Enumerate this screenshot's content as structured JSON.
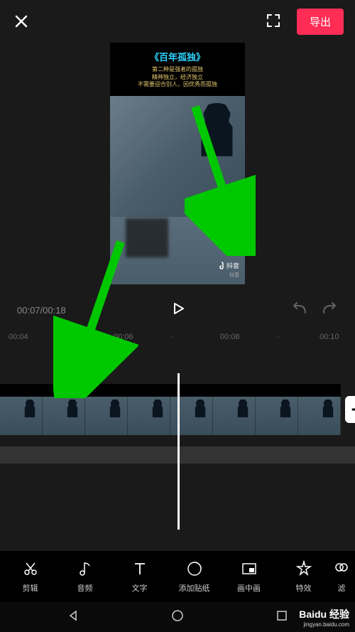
{
  "topbar": {
    "export_label": "导出"
  },
  "preview": {
    "title": "《百年孤独》",
    "line1": "第二种是强者的孤独",
    "line2": "精神独立，经济独立",
    "line3": "不需要迎合别人，因优秀而孤独",
    "platform_label": "抖音",
    "platform_sub": "抖音"
  },
  "playback": {
    "current_time": "00:07",
    "total_time": "00:18"
  },
  "timeline": {
    "ticks": [
      "00:04",
      "00:06",
      "00:08",
      "00:10"
    ]
  },
  "tools": [
    {
      "label": "剪辑",
      "icon": "cut"
    },
    {
      "label": "音频",
      "icon": "music"
    },
    {
      "label": "文字",
      "icon": "text"
    },
    {
      "label": "添加贴纸",
      "icon": "sticker"
    },
    {
      "label": "画中画",
      "icon": "pip"
    },
    {
      "label": "特效",
      "icon": "effects"
    },
    {
      "label": "滤",
      "icon": "filter"
    }
  ],
  "watermark": {
    "main": "Baidu 经验",
    "sub": "jingyan.baidu.com"
  }
}
